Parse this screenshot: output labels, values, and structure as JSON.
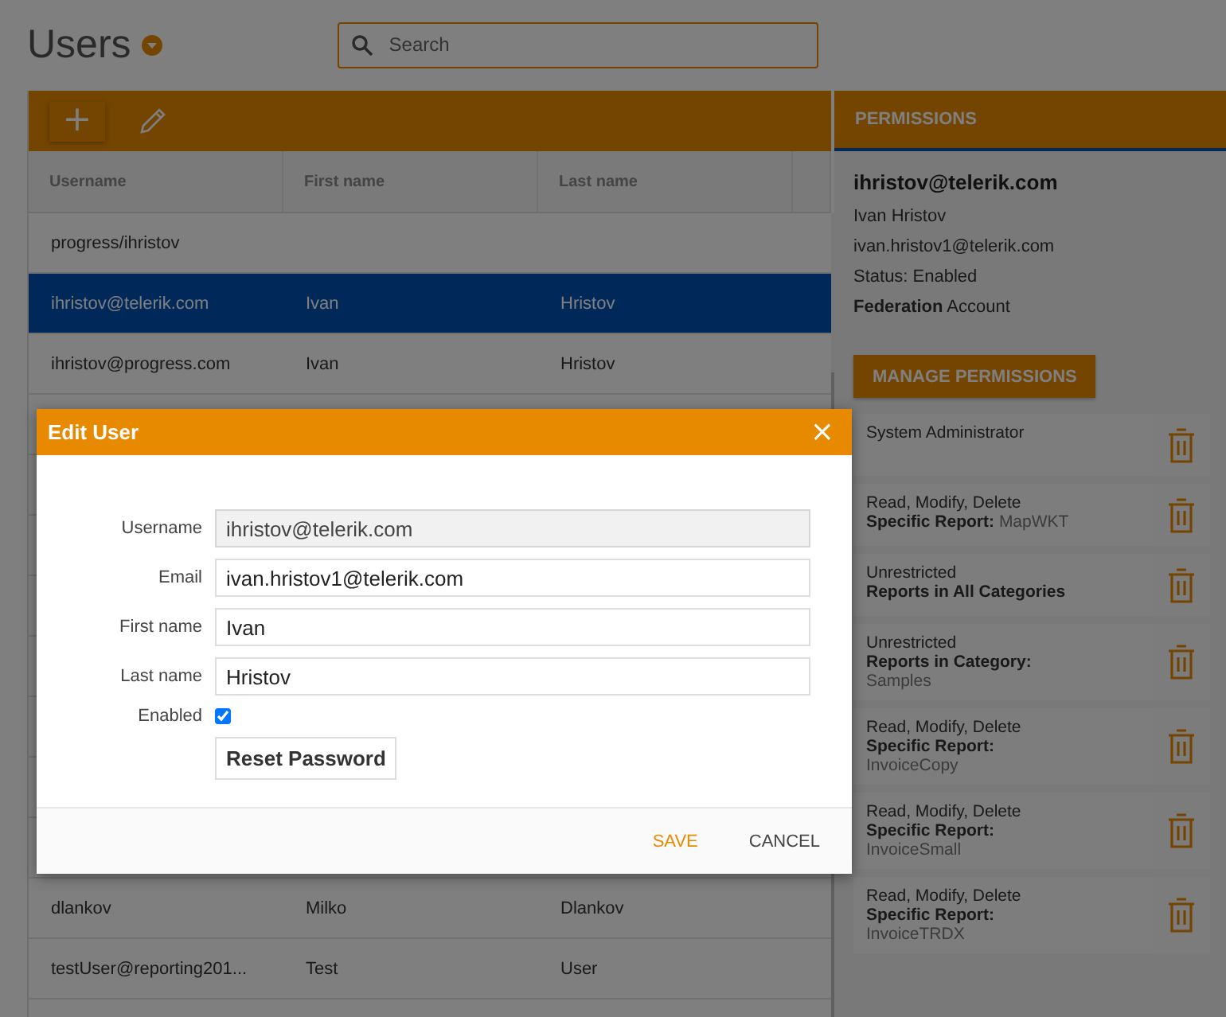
{
  "page": {
    "title": "Users",
    "search": {
      "placeholder": "Search"
    }
  },
  "toolbar": {
    "add": "+"
  },
  "table": {
    "columns": [
      "Username",
      "First name",
      "Last name"
    ],
    "rows": [
      {
        "cells": [
          "progress/ihristov",
          "",
          ""
        ],
        "selected": false
      },
      {
        "cells": [
          "ihristov@telerik.com",
          "Ivan",
          "Hristov"
        ],
        "selected": true
      },
      {
        "cells": [
          "ihristov@progress.com",
          "Ivan",
          "Hristov"
        ],
        "selected": false
      },
      {
        "cells": [
          "dlankov",
          "Milko",
          "Dlankov"
        ],
        "selected": false
      },
      {
        "cells": [
          "testUser@reporting201...",
          "Test",
          "User"
        ],
        "selected": false
      }
    ]
  },
  "permissions": {
    "header": "PERMISSIONS",
    "username": "ihristov@telerik.com",
    "full_name": "Ivan Hristov",
    "email": "ivan.hristov1@telerik.com",
    "status": "Status: Enabled",
    "account_label": "Federation",
    "account_suffix": " Account",
    "manage_button": "MANAGE PERMISSIONS",
    "items": [
      {
        "access": "System Administrator"
      },
      {
        "access": "Read, Modify, Delete",
        "scope": "Specific Report:",
        "target": "MapWKT",
        "inline": true
      },
      {
        "access": "Unrestricted",
        "scope": "Reports in All Categories"
      },
      {
        "access": "Unrestricted",
        "scope": "Reports in Category:",
        "target": "Samples",
        "inline": false
      },
      {
        "access": "Read, Modify, Delete",
        "scope": "Specific Report:",
        "target": "InvoiceCopy",
        "inline": false
      },
      {
        "access": "Read, Modify, Delete",
        "scope": "Specific Report:",
        "target": "InvoiceSmall",
        "inline": false
      },
      {
        "access": "Read, Modify, Delete",
        "scope": "Specific Report:",
        "target": "InvoiceTRDX",
        "inline": false
      }
    ]
  },
  "dialog": {
    "title": "Edit User",
    "close": "×",
    "fields": [
      {
        "label": "Username",
        "value": "ihristov@telerik.com",
        "disabled": true
      },
      {
        "label": "Email",
        "value": "ivan.hristov1@telerik.com",
        "disabled": false
      },
      {
        "label": "First name",
        "value": "Ivan",
        "disabled": false
      },
      {
        "label": "Last name",
        "value": "Hristov",
        "disabled": false
      }
    ],
    "enabled": {
      "label": "Enabled",
      "checked": true
    },
    "reset_button": "Reset Password",
    "buttons": [
      {
        "label": "SAVE",
        "kind": "primary"
      },
      {
        "label": "CANCEL",
        "kind": "secondary"
      }
    ]
  }
}
